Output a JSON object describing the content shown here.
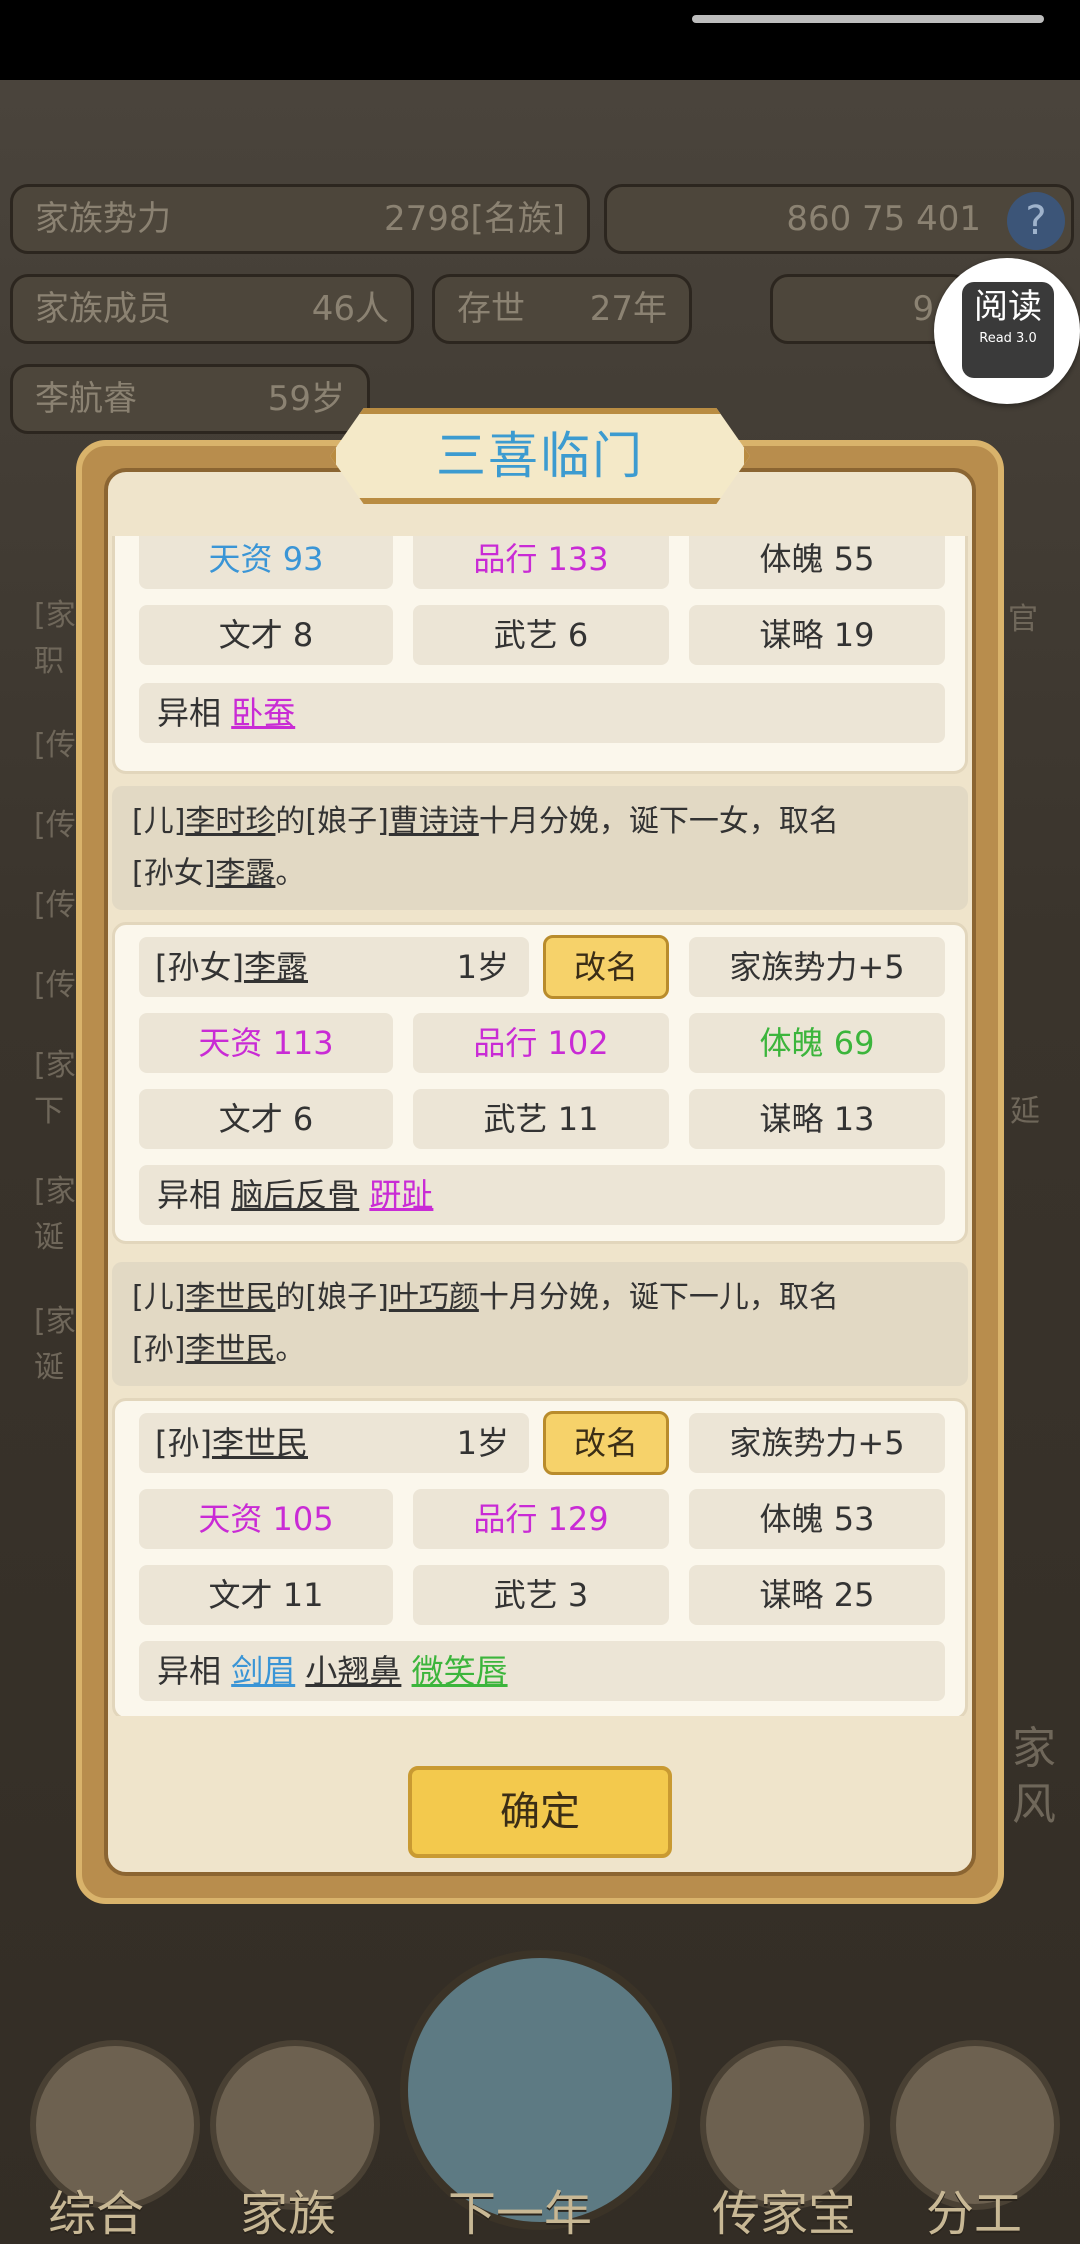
{
  "background": {
    "rows": [
      {
        "label": "家族势力",
        "value": "2798[名族]"
      },
      {
        "label": "家族成员",
        "value": "46人"
      },
      {
        "label": "存世",
        "value": "27年"
      },
      {
        "label": "李航睿",
        "value": "59岁"
      }
    ],
    "resources": "860 75 401",
    "side_text": [
      "9.",
      "[家",
      "职",
      "官",
      "[传",
      "[传",
      "[传",
      "[传",
      "[家",
      "下",
      "延",
      "[家",
      "诞",
      "[家",
      "诞",
      "家",
      "风"
    ]
  },
  "read_badge": {
    "label": "阅读",
    "sub": "Read 3.0"
  },
  "dialog": {
    "title": "三喜临门",
    "card0": {
      "row1": {
        "a": "天资 93",
        "b": "品行 133",
        "c": "体魄 55"
      },
      "row2": {
        "a": "文才 8",
        "b": "武艺 6",
        "c": "谋略 19"
      },
      "trait_label": "异相",
      "traits": [
        "卧蚕"
      ]
    },
    "msg1": {
      "p1": "[儿]",
      "n1": "李时珍",
      "p2": "的[娘子]",
      "n2": "曹诗诗",
      "p3": "十月分娩，诞下一女，取名",
      "p4": "[孙女]",
      "n3": "李露",
      "p5": "。"
    },
    "card1": {
      "prefix": "[孙女]",
      "name": "李露",
      "age": "1岁",
      "rename": "改名",
      "bonus": "家族势力+5",
      "row1": {
        "a": "天资 113",
        "b": "品行 102",
        "c": "体魄 69"
      },
      "row2": {
        "a": "文才 6",
        "b": "武艺 11",
        "c": "谋略 13"
      },
      "trait_label": "异相",
      "traits": [
        "脑后反骨",
        "趼趾"
      ]
    },
    "msg2": {
      "p1": "[儿]",
      "n1": "李世民",
      "p2": "的[娘子]",
      "n2": "叶巧颜",
      "p3": "十月分娩，诞下一儿，取名",
      "p4": "[孙]",
      "n3": "李世民",
      "p5": "。"
    },
    "card2": {
      "prefix": "[孙]",
      "name": "李世民",
      "age": "1岁",
      "rename": "改名",
      "bonus": "家族势力+5",
      "row1": {
        "a": "天资 105",
        "b": "品行 129",
        "c": "体魄 53"
      },
      "row2": {
        "a": "文才 11",
        "b": "武艺 3",
        "c": "谋略 25"
      },
      "trait_label": "异相",
      "traits": [
        "剑眉",
        "小翘鼻",
        "微笑唇"
      ]
    },
    "confirm": "确定"
  },
  "nav": {
    "items": [
      "综合",
      "家族",
      "下一年",
      "传家宝",
      "分工"
    ]
  }
}
